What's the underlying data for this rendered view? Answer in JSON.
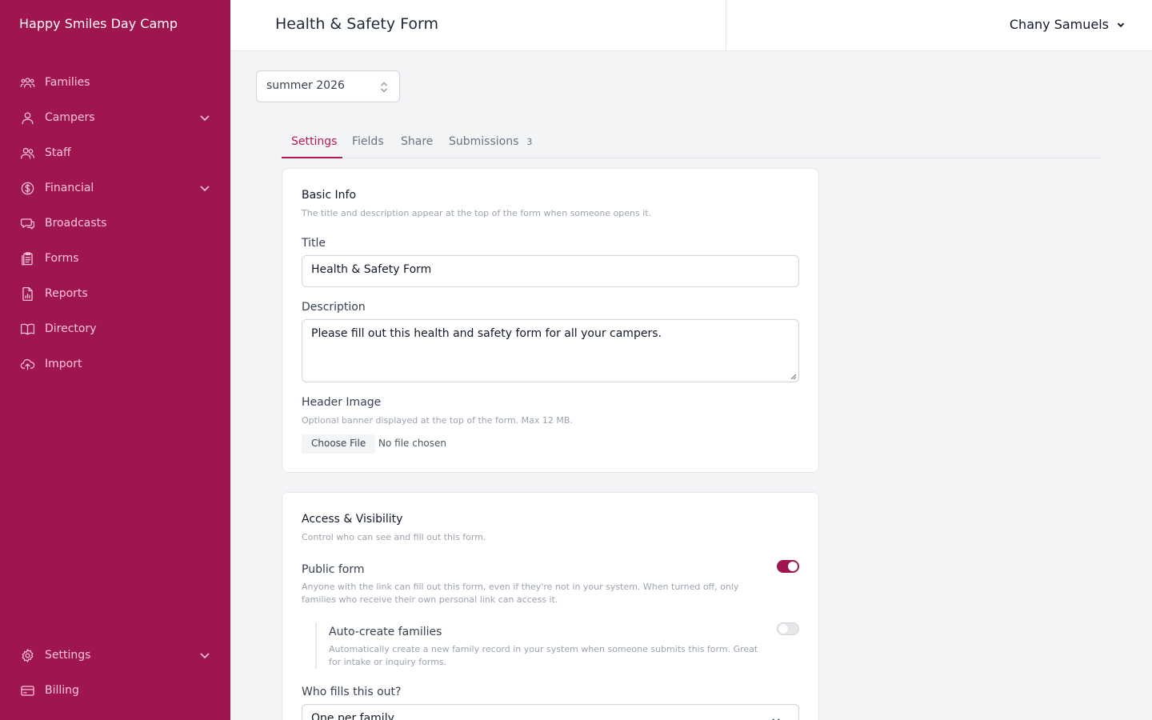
{
  "app": {
    "brand": "Happy Smiles Day Camp"
  },
  "colors": {
    "brand": "#9e1550",
    "accent": "#b5195a"
  },
  "sidebar": {
    "items": [
      {
        "label": "Families",
        "icon": "users-group-icon",
        "expandable": false
      },
      {
        "label": "Campers",
        "icon": "user-icon",
        "expandable": true
      },
      {
        "label": "Staff",
        "icon": "users-icon",
        "expandable": false
      },
      {
        "label": "Financial",
        "icon": "dollar-circle-icon",
        "expandable": true
      },
      {
        "label": "Broadcasts",
        "icon": "chat-icon",
        "expandable": false
      },
      {
        "label": "Forms",
        "icon": "clipboard-icon",
        "expandable": false
      },
      {
        "label": "Reports",
        "icon": "chart-file-icon",
        "expandable": false
      },
      {
        "label": "Directory",
        "icon": "book-open-icon",
        "expandable": false
      },
      {
        "label": "Import",
        "icon": "cloud-upload-icon",
        "expandable": false
      }
    ],
    "bottom_items": [
      {
        "label": "Settings",
        "icon": "gear-icon",
        "expandable": true
      },
      {
        "label": "Billing",
        "icon": "credit-card-icon",
        "expandable": false
      }
    ]
  },
  "header": {
    "title": "Health & Safety Form",
    "user_name": "Chany Samuels"
  },
  "season_select": {
    "value": "summer 2026"
  },
  "tabs": [
    {
      "label": "Settings",
      "active": true,
      "count": ""
    },
    {
      "label": "Fields",
      "active": false,
      "count": ""
    },
    {
      "label": "Share",
      "active": false,
      "count": ""
    },
    {
      "label": "Submissions",
      "active": false,
      "count": "3"
    }
  ],
  "basic_info": {
    "title": "Basic Info",
    "subtitle": "The title and description appear at the top of the form when someone opens it.",
    "title_label": "Title",
    "title_value": "Health & Safety Form",
    "description_label": "Description",
    "description_value": "Please fill out this health and safety form for all your campers.",
    "header_image_label": "Header Image",
    "header_image_hint": "Optional banner displayed at the top of the form. Max 12 MB.",
    "choose_file_label": "Choose File",
    "no_file_text": "No file chosen"
  },
  "access": {
    "title": "Access & Visibility",
    "subtitle": "Control who can see and fill out this form.",
    "public_label": "Public form",
    "public_desc": "Anyone with the link can fill out this form, even if they're not in your system. When turned off, only families who receive their own personal link can access it.",
    "public_on": true,
    "auto_label": "Auto-create families",
    "auto_desc": "Automatically create a new family record in your system when someone submits this form. Great for intake or inquiry forms.",
    "auto_on": false,
    "who_label": "Who fills this out?",
    "who_value": "One per family"
  }
}
